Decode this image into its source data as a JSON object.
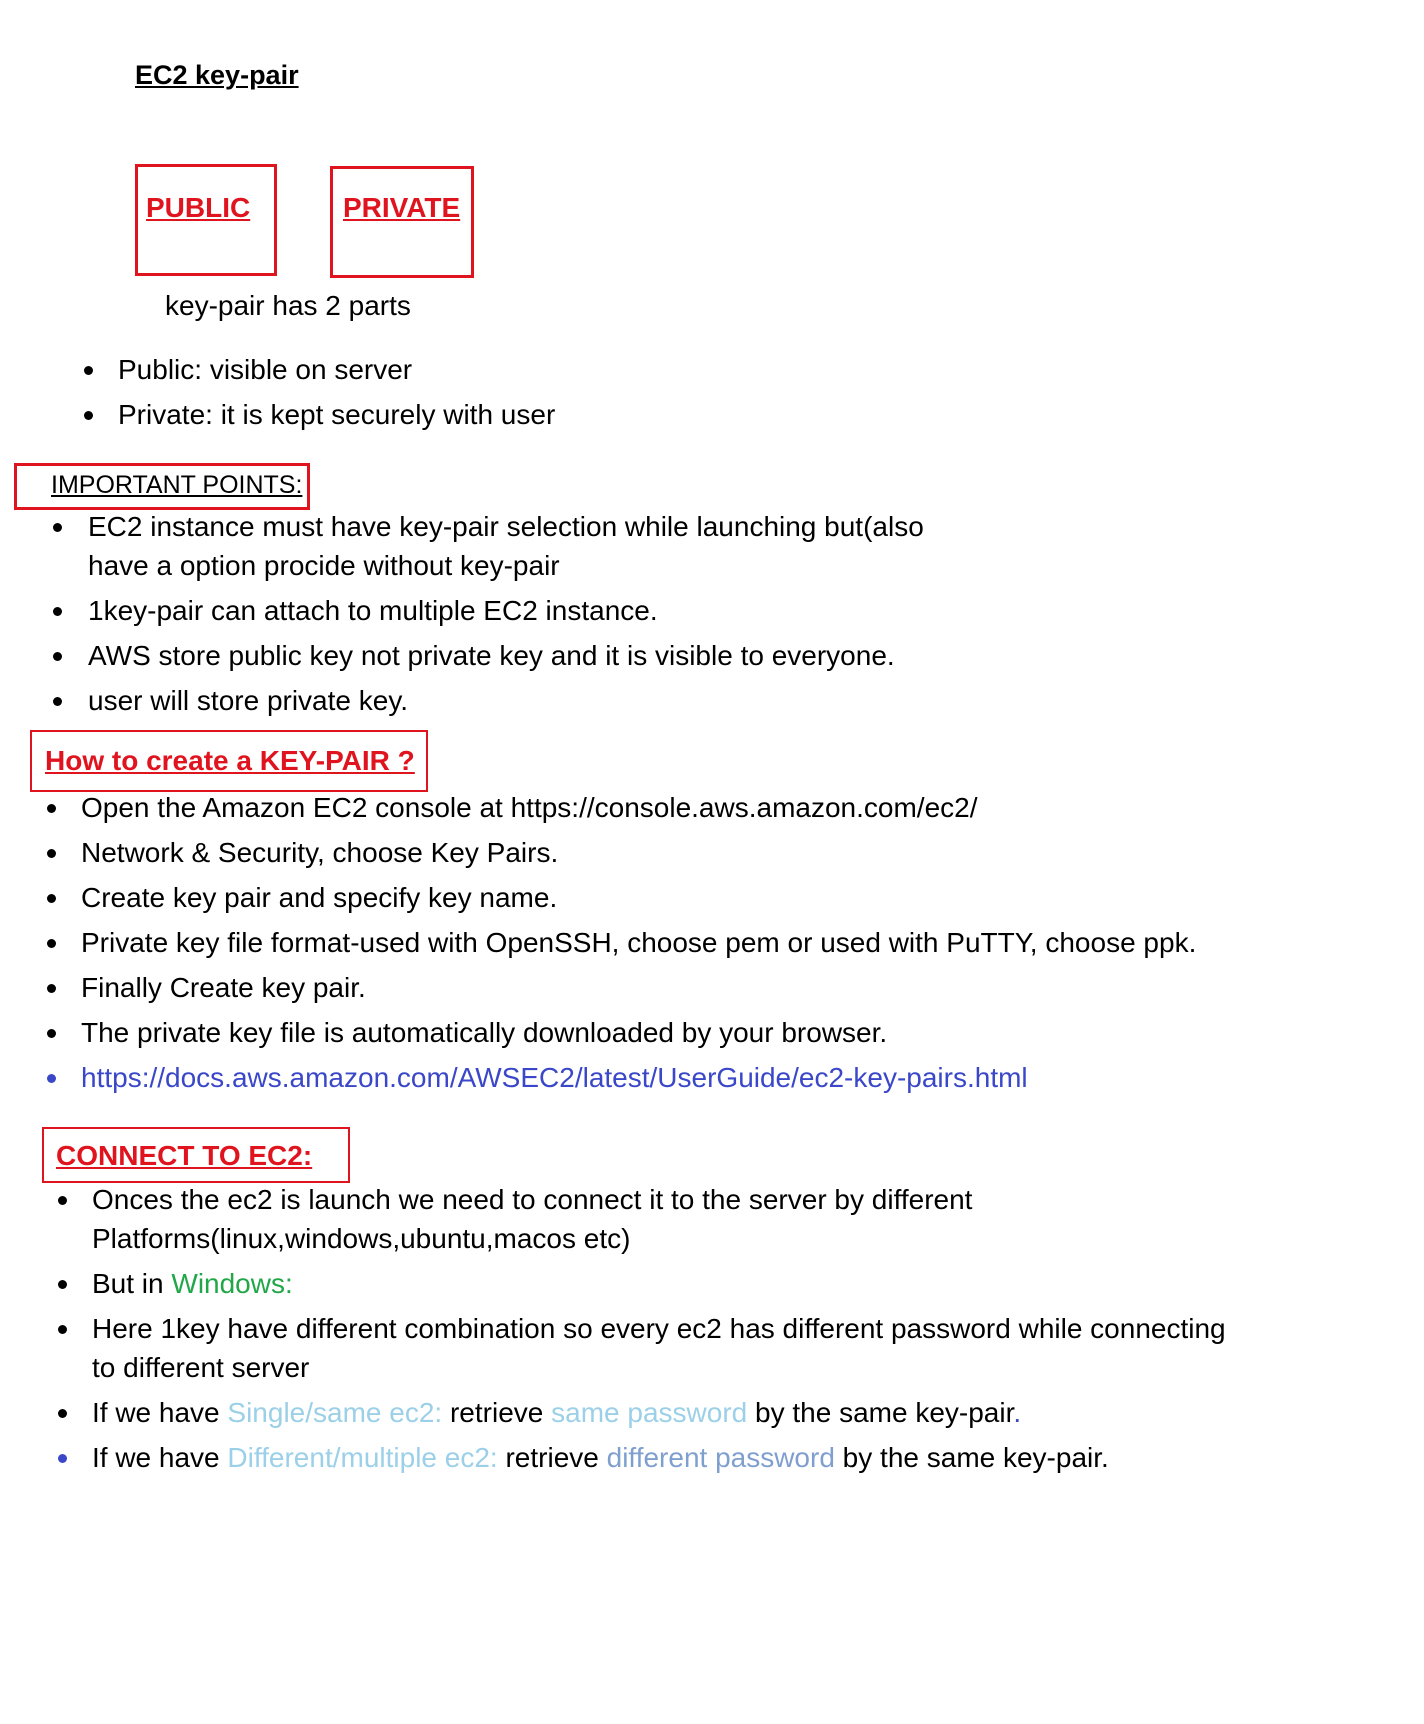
{
  "title": "EC2 key-pair",
  "key_parts": {
    "public_label": "PUBLIC",
    "private_label": "PRIVATE",
    "caption": "key-pair has 2 parts"
  },
  "parts_list": [
    "Public: visible on server",
    "Private: it is kept securely with user"
  ],
  "important": {
    "heading": "IMPORTANT POINTS:",
    "items": [
      "EC2 instance must have key-pair selection while launching but(also",
      "have a option procide without key-pair",
      "1key-pair can attach to multiple EC2 instance.",
      "AWS store public key not private key and it is visible to everyone.",
      "user will store private key."
    ]
  },
  "create": {
    "heading": "How to create a KEY-PAIR ?",
    "items": [
      "Open the Amazon EC2 console at https://console.aws.amazon.com/ec2/",
      "Network & Security, choose Key Pairs.",
      "Create key pair and specify key name.",
      "Private key file format-used with OpenSSH, choose pem or used with PuTTY, choose ppk.",
      "Finally Create key pair.",
      "The private key file is automatically downloaded by your browser."
    ],
    "link": "https://docs.aws.amazon.com/AWSEC2/latest/UserGuide/ec2-key-pairs.html"
  },
  "connect": {
    "heading": "CONNECT TO EC2:",
    "item1_line1": "Onces the ec2 is launch we need to connect it to the server by different",
    "item1_line2": "Platforms(linux,windows,ubuntu,macos etc)",
    "item2_prefix": "But in ",
    "item2_highlight": "Windows:",
    "item3_line1": "Here 1key have different combination so every ec2 has different password while connecting",
    "item3_line2": "to different server",
    "item4": {
      "p1": "If we have ",
      "h1": "Single/same ec2:",
      "p2": " retrieve ",
      "h2": "same password",
      "p3": " by the same key-pair",
      "p4": "."
    },
    "item5": {
      "p1": "If we have ",
      "h1": "Different/multiple ec2:",
      "p2": " retrieve ",
      "h2": "different password",
      "p3": " by the same key-pair."
    }
  },
  "colors": {
    "red": "#e0141e",
    "link_blue": "#3a47c8",
    "green": "#21a748",
    "light_blue": "#9bd0e8",
    "steel_blue": "#7f9fcf"
  }
}
